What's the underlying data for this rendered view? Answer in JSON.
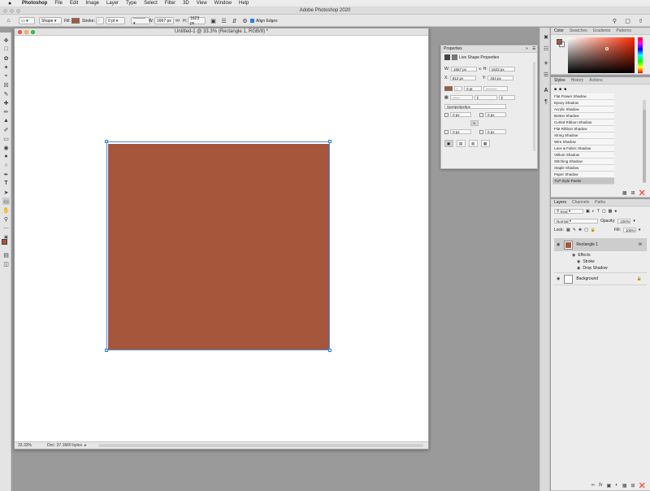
{
  "menubar": {
    "apple": "",
    "app": "Photoshop",
    "items": [
      "File",
      "Edit",
      "Image",
      "Layer",
      "Type",
      "Select",
      "Filter",
      "3D",
      "View",
      "Window",
      "Help"
    ]
  },
  "window": {
    "title": "Adobe Photoshop 2020"
  },
  "options": {
    "mode": "Shape",
    "fill_label": "Fill:",
    "stroke_label": "Stroke:",
    "stroke_width": "0 pt",
    "w_label": "W:",
    "w_value": "1667 px",
    "h_label": "H:",
    "h_value": "1623 px",
    "align_edges": "Align Edges",
    "fill_color": "#a6573b"
  },
  "document": {
    "title": "Untitled-1 @ 33.3% (Rectangle 1, RGB/8) *",
    "zoom": "33.33%",
    "doc_size": "Doc: 37.1M/0 bytes",
    "shape_color": "#a6573b"
  },
  "properties": {
    "tab": "Properties",
    "section": "Live Shape Properties",
    "w_label": "W:",
    "w": "1667 px",
    "h_label": "H:",
    "h": "1623 px",
    "x_label": "X:",
    "x": "812 px",
    "y_label": "Y:",
    "y": "334 px",
    "stroke_width": "0 pt",
    "radius": "0px0px0px0px",
    "r1": "0 px",
    "r2": "0 px",
    "r3": "0 px",
    "r4": "0 px"
  },
  "color_panel": {
    "tabs": [
      "Color",
      "Swatches",
      "Gradients",
      "Patterns"
    ]
  },
  "styles_panel": {
    "tabs": [
      "Styles",
      "History",
      "Actions"
    ],
    "items": [
      "Flat Flower Shadow",
      "Epoxy Shadow",
      "Acrylic Shadow",
      "Button Shadow",
      "Curled Ribbon Shadow",
      "Flat Ribbon Shadow",
      "String Shadow",
      "Wire Shadow",
      "Lace & Fabric Shadow",
      "Vellum Shadow",
      "Stitching Shadow",
      "Staple Shadow",
      "Paper Shadow",
      "TLP Style Peeler"
    ]
  },
  "layers_panel": {
    "tabs": [
      "Layers",
      "Channels",
      "Paths"
    ],
    "kind": "Kind",
    "blend": "Normal",
    "opacity_label": "Opacity:",
    "opacity": "100%",
    "lock_label": "Lock:",
    "fill_label": "Fill:",
    "fill": "100%",
    "layers": [
      {
        "name": "Rectangle 1",
        "fx": "fx"
      },
      {
        "name": "Background"
      }
    ],
    "effects_label": "Effects",
    "effects": [
      "Stroke",
      "Drop Shadow"
    ]
  }
}
